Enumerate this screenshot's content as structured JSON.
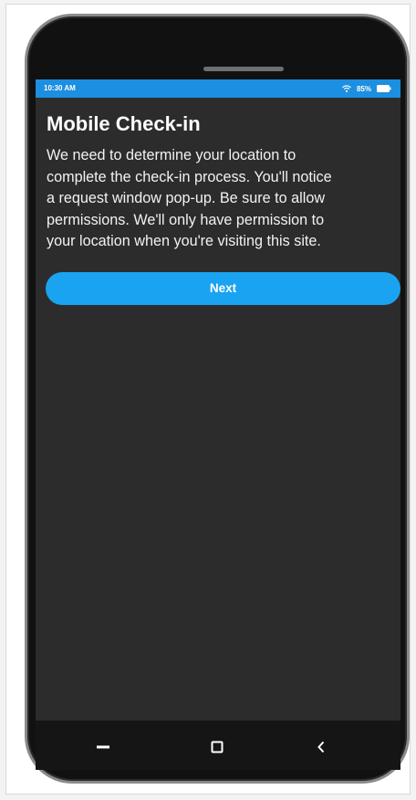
{
  "status_bar": {
    "time": "10:30 AM",
    "battery": "85%",
    "icons": [
      "wifi-icon",
      "battery-icon"
    ]
  },
  "screen": {
    "title": "Mobile Check-in",
    "message_lines": [
      "We need to determine your location to",
      "complete the check-in process. You'll notice",
      "a request window pop-up. Be sure to allow",
      "permissions. We'll only have permission to",
      "your location when you're visiting this site."
    ],
    "next_label": "Next"
  },
  "nav": {
    "icons": [
      "recent-apps-icon",
      "home-icon",
      "back-icon"
    ]
  },
  "colors": {
    "status_bar": "#1c8fe0",
    "accent": "#1aa3f0",
    "screen_bg": "#2c2c2c",
    "phone_body": "#111111"
  }
}
